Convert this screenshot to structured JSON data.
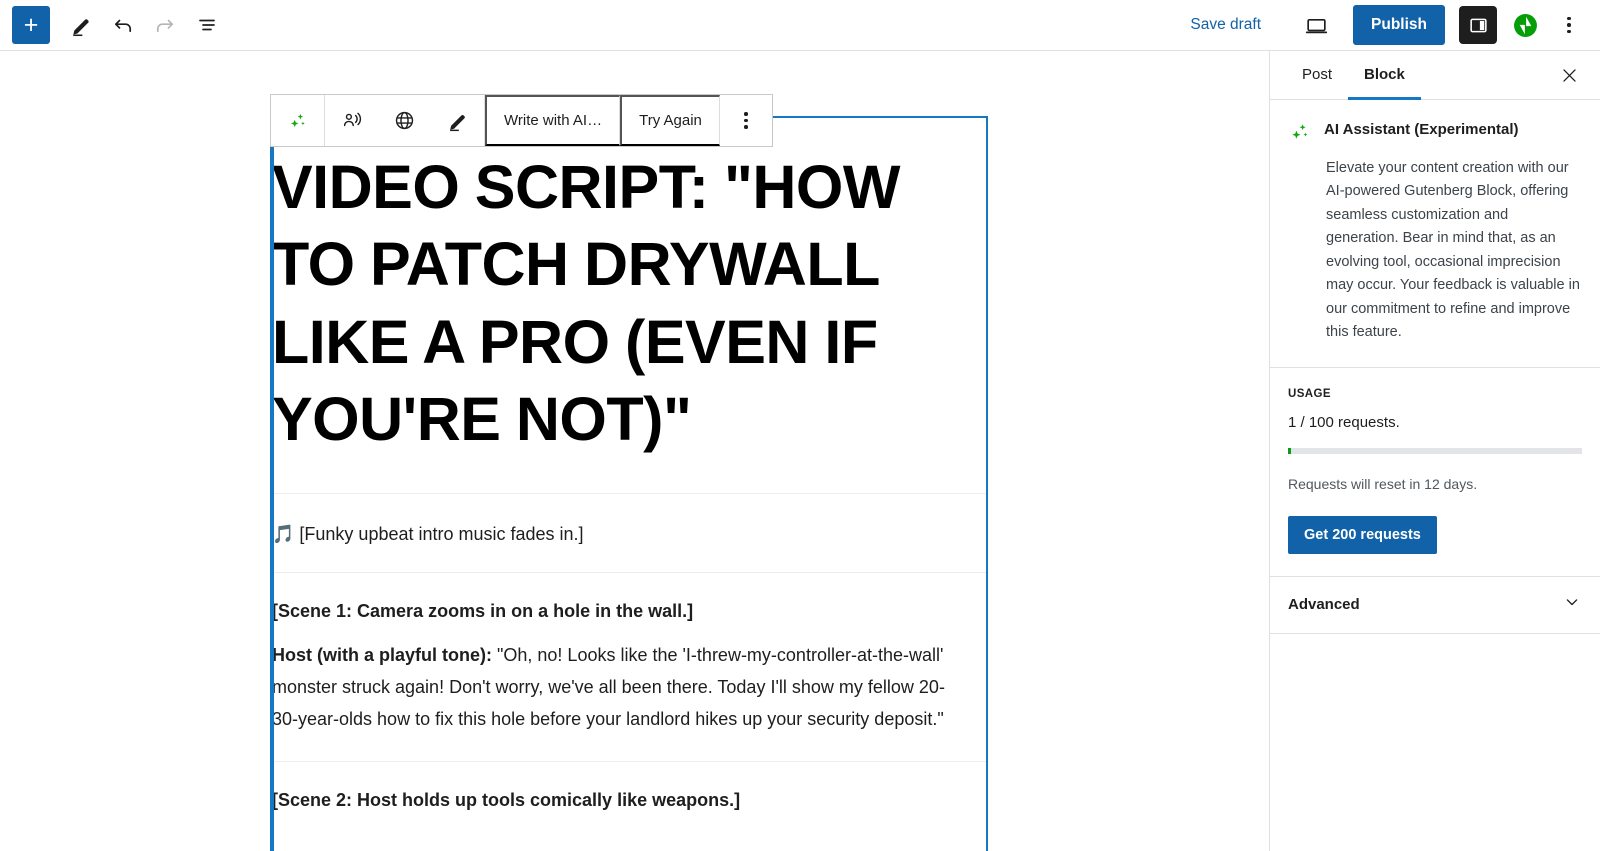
{
  "topbar": {
    "add_block_label": "+",
    "tools_icon": "pencil-icon",
    "undo_icon": "undo-icon",
    "redo_icon": "redo-icon",
    "list_view_icon": "list-view-icon",
    "save_draft_label": "Save draft",
    "preview_icon": "desktop-preview-icon",
    "publish_label": "Publish",
    "settings_toggle_icon": "sidebar-panel-icon",
    "jetpack_icon": "jetpack-icon",
    "more_menu_icon": "ellipsis-vertical-icon"
  },
  "block_toolbar": {
    "ai_icon": "sparkles-icon",
    "tone_icon": "person-speaking-icon",
    "language_icon": "globe-icon",
    "improve_icon": "pencil-icon",
    "write_with_ai_label": "Write with AI…",
    "try_again_label": "Try Again",
    "more_icon": "ellipsis-vertical-icon"
  },
  "document": {
    "heading": "VIDEO SCRIPT: \"HOW TO PATCH DRYWALL LIKE A PRO (EVEN IF YOU'RE NOT)\"",
    "music_line": "🎵 [Funky upbeat intro music fades in.]",
    "scene_1": "[Scene 1: Camera zooms in on a hole in the wall.]",
    "host_label": "Host (with a playful tone):",
    "host_line": " \"Oh, no! Looks like the 'I-threw-my-controller-at-the-wall' monster struck again! Don't worry, we've all been there. Today I'll show my fellow 20-30-year-olds how to fix this hole before your landlord hikes up your security deposit.\"",
    "scene_2": "[Scene 2: Host holds up tools comically like weapons.]"
  },
  "sidebar": {
    "tab_post": "Post",
    "tab_block": "Block",
    "close_icon": "close-icon",
    "ai_assistant": {
      "icon": "sparkles-icon",
      "title": "AI Assistant (Experimental)",
      "description": "Elevate your content creation with our AI-powered Gutenberg Block, offering seamless customization and generation. Bear in mind that, as an evolving tool, occasional imprecision may occur. Your feedback is valuable in our commitment to refine and improve this feature."
    },
    "usage": {
      "label": "USAGE",
      "count_text": "1 / 100 requests.",
      "progress_percent": 1,
      "reset_text": "Requests will reset in 12 days.",
      "cta_label": "Get 200 requests"
    },
    "advanced": {
      "label": "Advanced",
      "chevron_icon": "chevron-down-icon"
    }
  },
  "colors": {
    "accent_blue": "#1162a8",
    "selection_blue": "#1678c2",
    "sparkle_green": "#0fab0f",
    "jetpack_green": "#069e08",
    "progress_green": "#0d9d13"
  }
}
